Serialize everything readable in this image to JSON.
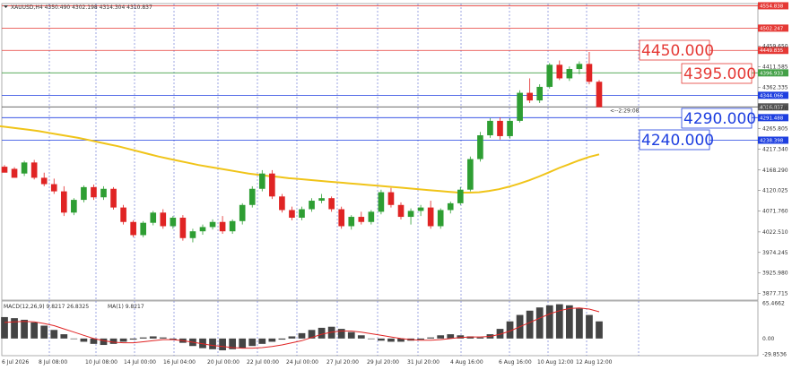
{
  "chart_data": {
    "type": "candlestick",
    "title": "XAUUSD,H4  4350.490 4302.198 4314.304 4310.837",
    "countdown": "<--2:29:08",
    "price_axis": {
      "ticks": [
        "4459.650",
        "4411.585",
        "4362.335",
        "4313.070",
        "4265.805",
        "4217.340",
        "4168.290",
        "4120.025",
        "4071.760",
        "4022.510",
        "3974.245",
        "3925.980",
        "3877.715"
      ],
      "values": [
        4459.65,
        4411.585,
        4362.335,
        4313.07,
        4265.805,
        4217.34,
        4168.29,
        4120.025,
        4071.76,
        4022.51,
        3974.245,
        3925.98,
        3877.715
      ],
      "range": [
        3862,
        4560
      ]
    },
    "time_axis": {
      "labels": [
        "6 Jul 2026",
        "8 Jul 08:00",
        "10 Jul 08:00",
        "14 Jul 00:00",
        "16 Jul 04:00",
        "20 Jul 00:00",
        "22 Jul 00:00",
        "24 Jul 00:00",
        "27 Jul 20:00",
        "29 Jul 20:00",
        "31 Jul 20:00",
        "4 Aug 16:00",
        "6 Aug 16:00",
        "10 Aug 12:00",
        "12 Aug 12:00"
      ]
    },
    "horizontal_levels": [
      {
        "price": 4554.838,
        "label": "4554.838",
        "color": "#e53935",
        "big": null
      },
      {
        "price": 4502.247,
        "label": "4502.247",
        "color": "#e53935",
        "big": null
      },
      {
        "price": 4449.835,
        "label": "4449.835",
        "color": "#e53935",
        "big": "4450.000"
      },
      {
        "price": 4396.933,
        "label": "4396.933",
        "color": "#43a047",
        "big": "4395.000"
      },
      {
        "price": 4344.066,
        "label": "4344.066",
        "color": "#1e3fe0",
        "big": null
      },
      {
        "price": 4316.837,
        "label": "4316.837",
        "color": "#555555",
        "big": null
      },
      {
        "price": 4291.488,
        "label": "4291.488",
        "color": "#1e3fe0",
        "big": "4290.000"
      },
      {
        "price": 4238.398,
        "label": "4238.398",
        "color": "#1e3fe0",
        "big": "4240.000"
      }
    ],
    "colors": {
      "up": "#2e9e33",
      "down": "#e02424",
      "ma": "#f0c419",
      "level_red": "#e53935",
      "level_blue": "#1e3fe0",
      "level_green": "#43a047"
    },
    "ma": {
      "name": "MA",
      "values": [
        4272,
        4269,
        4266,
        4263,
        4260,
        4256,
        4252,
        4248,
        4244,
        4239,
        4234,
        4229,
        4224,
        4218,
        4212,
        4206,
        4200,
        4195,
        4190,
        4185,
        4180,
        4176,
        4172,
        4168,
        4164,
        4160,
        4157,
        4154,
        4152,
        4149,
        4147,
        4145,
        4143,
        4141,
        4139,
        4137,
        4135,
        4133,
        4131,
        4129,
        4127,
        4125,
        4123,
        4121,
        4119,
        4117,
        4115,
        4115,
        4116,
        4119,
        4123,
        4129,
        4136,
        4144,
        4153,
        4163,
        4173,
        4182,
        4191,
        4199,
        4205
      ]
    },
    "candles": [
      [
        4176,
        4180,
        4168,
        4162
      ],
      [
        4171,
        4175,
        4160,
        4150
      ],
      [
        4160,
        4190,
        4154,
        4186
      ],
      [
        4186,
        4192,
        4146,
        4150
      ],
      [
        4150,
        4162,
        4130,
        4135
      ],
      [
        4135,
        4148,
        4112,
        4118
      ],
      [
        4118,
        4130,
        4060,
        4068
      ],
      [
        4068,
        4102,
        4062,
        4098
      ],
      [
        4098,
        4132,
        4092,
        4128
      ],
      [
        4128,
        4134,
        4098,
        4104
      ],
      [
        4104,
        4130,
        4098,
        4124
      ],
      [
        4124,
        4128,
        4075,
        4080
      ],
      [
        4080,
        4086,
        4040,
        4046
      ],
      [
        4046,
        4050,
        4010,
        4015
      ],
      [
        4015,
        4048,
        4010,
        4044
      ],
      [
        4044,
        4072,
        4038,
        4068
      ],
      [
        4068,
        4076,
        4030,
        4036
      ],
      [
        4036,
        4060,
        4030,
        4056
      ],
      [
        4056,
        4062,
        4002,
        4008
      ],
      [
        4008,
        4030,
        3998,
        4024
      ],
      [
        4024,
        4040,
        4016,
        4034
      ],
      [
        4034,
        4052,
        4028,
        4046
      ],
      [
        4046,
        4060,
        4018,
        4024
      ],
      [
        4024,
        4052,
        4018,
        4048
      ],
      [
        4048,
        4090,
        4040,
        4086
      ],
      [
        4086,
        4130,
        4080,
        4124
      ],
      [
        4124,
        4168,
        4118,
        4160
      ],
      [
        4160,
        4168,
        4100,
        4106
      ],
      [
        4106,
        4112,
        4068,
        4074
      ],
      [
        4074,
        4082,
        4050,
        4056
      ],
      [
        4056,
        4082,
        4050,
        4076
      ],
      [
        4076,
        4102,
        4070,
        4096
      ],
      [
        4096,
        4112,
        4090,
        4102
      ],
      [
        4102,
        4106,
        4070,
        4076
      ],
      [
        4076,
        4082,
        4030,
        4036
      ],
      [
        4036,
        4062,
        4028,
        4058
      ],
      [
        4058,
        4070,
        4040,
        4046
      ],
      [
        4046,
        4074,
        4040,
        4070
      ],
      [
        4070,
        4122,
        4064,
        4116
      ],
      [
        4116,
        4126,
        4080,
        4086
      ],
      [
        4086,
        4092,
        4052,
        4058
      ],
      [
        4058,
        4078,
        4040,
        4072
      ],
      [
        4072,
        4086,
        4060,
        4080
      ],
      [
        4080,
        4096,
        4030,
        4036
      ],
      [
        4036,
        4078,
        4030,
        4074
      ],
      [
        4074,
        4094,
        4066,
        4090
      ],
      [
        4090,
        4128,
        4086,
        4122
      ],
      [
        4122,
        4200,
        4118,
        4194
      ],
      [
        4194,
        4258,
        4188,
        4250
      ],
      [
        4250,
        4290,
        4244,
        4284
      ],
      [
        4284,
        4292,
        4240,
        4248
      ],
      [
        4248,
        4290,
        4242,
        4284
      ],
      [
        4284,
        4356,
        4280,
        4350
      ],
      [
        4350,
        4384,
        4326,
        4332
      ],
      [
        4332,
        4370,
        4326,
        4364
      ],
      [
        4364,
        4420,
        4360,
        4416
      ],
      [
        4416,
        4426,
        4380,
        4384
      ],
      [
        4384,
        4412,
        4378,
        4406
      ],
      [
        4406,
        4424,
        4394,
        4418
      ],
      [
        4418,
        4446,
        4370,
        4376
      ],
      [
        4376,
        4380,
        4324,
        4316
      ]
    ],
    "macd": {
      "label": "MACD(12,26,9) 9.8217 26.8325",
      "ma_label": "MA(1) 9.8217",
      "axis_ticks": [
        "65.4662",
        "0.00",
        "-29.8536"
      ],
      "axis_values": [
        65.4662,
        0,
        -29.8536
      ],
      "range": [
        -32,
        70
      ],
      "histogram": [
        40,
        38,
        35,
        30,
        24,
        16,
        8,
        0,
        -6,
        -10,
        -12,
        -10,
        -6,
        -2,
        2,
        4,
        2,
        -2,
        -8,
        -14,
        -18,
        -20,
        -22,
        -20,
        -18,
        -14,
        -10,
        -6,
        -2,
        4,
        10,
        16,
        20,
        22,
        18,
        12,
        6,
        0,
        -4,
        -6,
        -6,
        -4,
        -2,
        2,
        6,
        8,
        6,
        4,
        2,
        8,
        18,
        32,
        44,
        52,
        58,
        62,
        64,
        62,
        56,
        44,
        32
      ],
      "signal": [
        30,
        31,
        32,
        31,
        28,
        24,
        18,
        12,
        6,
        0,
        -4,
        -7,
        -8,
        -8,
        -6,
        -4,
        -2,
        -2,
        -4,
        -7,
        -10,
        -13,
        -15,
        -17,
        -18,
        -18,
        -17,
        -15,
        -12,
        -8,
        -4,
        2,
        8,
        12,
        14,
        14,
        12,
        9,
        6,
        3,
        0,
        -2,
        -3,
        -3,
        -2,
        0,
        2,
        3,
        3,
        4,
        8,
        14,
        22,
        30,
        38,
        46,
        52,
        56,
        57,
        55,
        50
      ]
    }
  }
}
